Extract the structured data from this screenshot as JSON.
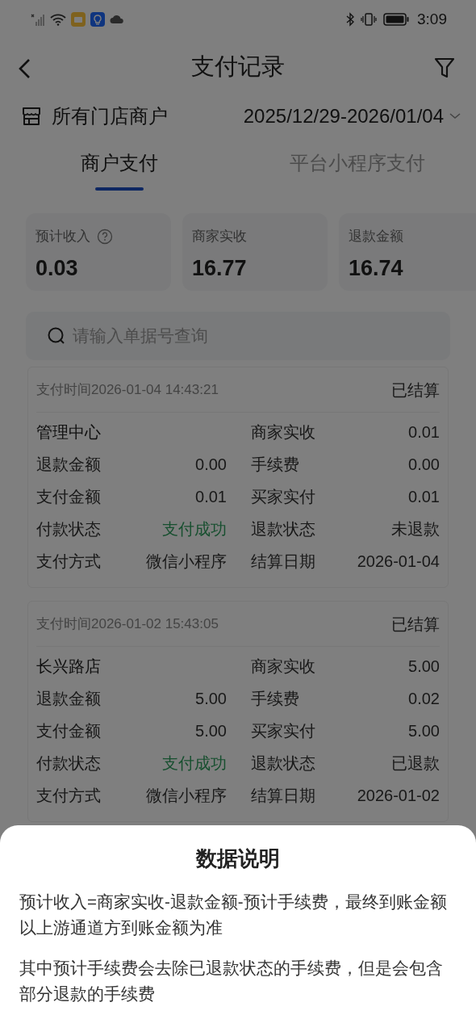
{
  "status_bar": {
    "time": "3:09"
  },
  "header": {
    "title": "支付记录"
  },
  "filter_row": {
    "store": "所有门店商户",
    "date_range": "2025/12/29-2026/01/04"
  },
  "tabs": [
    {
      "label": "商户支付",
      "selected": true
    },
    {
      "label": "平台小程序支付",
      "selected": false
    }
  ],
  "summary": [
    {
      "label": "预计收入",
      "value": "0.03",
      "help": true
    },
    {
      "label": "商家实收",
      "value": "16.77",
      "help": false
    },
    {
      "label": "退款金额",
      "value": "16.74",
      "help": false
    }
  ],
  "search": {
    "placeholder": "请输入单据号查询"
  },
  "records": [
    {
      "time": "支付时间2026-01-04 14:43:21",
      "settlement": "已结算",
      "rows": [
        [
          {
            "label": "管理中心",
            "kind": "name"
          },
          {
            "label": "商家实收",
            "value": "0.01",
            "kind": "text"
          }
        ],
        [
          {
            "label": "退款金额",
            "value": "0.00",
            "kind": "text"
          },
          {
            "label": "手续费",
            "value": "0.00",
            "kind": "text"
          }
        ],
        [
          {
            "label": "支付金额",
            "value": "0.01",
            "kind": "text"
          },
          {
            "label": "买家实付",
            "value": "0.01",
            "kind": "text"
          }
        ],
        [
          {
            "label": "付款状态",
            "value": "支付成功",
            "kind": "success"
          },
          {
            "label": "退款状态",
            "value": "未退款",
            "kind": "text"
          }
        ],
        [
          {
            "label": "支付方式",
            "value": "微信小程序",
            "kind": "text"
          },
          {
            "label": "结算日期",
            "value": "2026-01-04",
            "kind": "text"
          }
        ]
      ]
    },
    {
      "time": "支付时间2026-01-02 15:43:05",
      "settlement": "已结算",
      "rows": [
        [
          {
            "label": "长兴路店",
            "kind": "name"
          },
          {
            "label": "商家实收",
            "value": "5.00",
            "kind": "text"
          }
        ],
        [
          {
            "label": "退款金额",
            "value": "5.00",
            "kind": "text"
          },
          {
            "label": "手续费",
            "value": "0.02",
            "kind": "text"
          }
        ],
        [
          {
            "label": "支付金额",
            "value": "5.00",
            "kind": "text"
          },
          {
            "label": "买家实付",
            "value": "5.00",
            "kind": "text"
          }
        ],
        [
          {
            "label": "付款状态",
            "value": "支付成功",
            "kind": "success"
          },
          {
            "label": "退款状态",
            "value": "已退款",
            "kind": "text"
          }
        ],
        [
          {
            "label": "支付方式",
            "value": "微信小程序",
            "kind": "text"
          },
          {
            "label": "结算日期",
            "value": "2026-01-02",
            "kind": "text"
          }
        ]
      ]
    }
  ],
  "sheet": {
    "title": "数据说明",
    "paragraphs": [
      "预计收入=商家实收-退款金额-预计手续费，最终到账金额以上游通道方到账金额为准",
      "其中预计手续费会去除已退款状态的手续费，但是会包含部分退款的手续费"
    ]
  }
}
